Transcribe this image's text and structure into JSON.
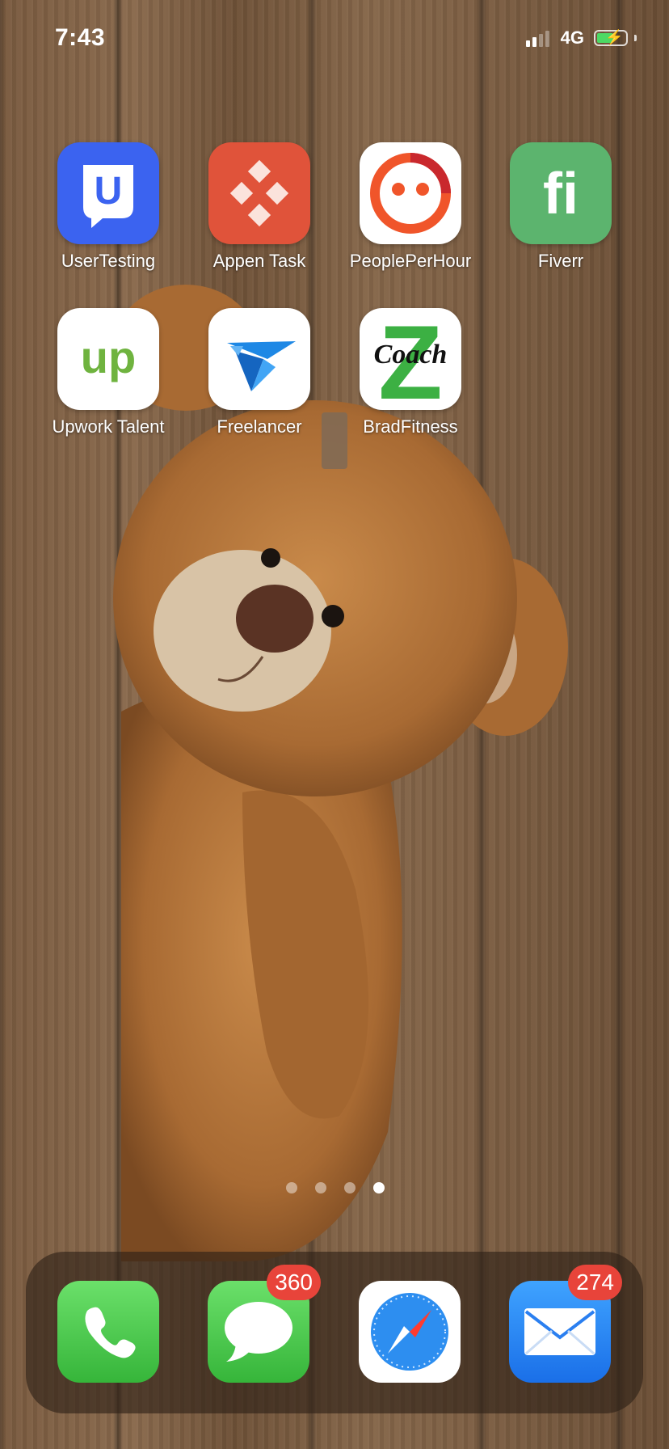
{
  "status_bar": {
    "time": "7:43",
    "network": "4G",
    "battery_charging": true
  },
  "apps": [
    {
      "label": "UserTesting",
      "icon": "usertesting-icon",
      "color": "#3b63f0"
    },
    {
      "label": "Appen Task",
      "icon": "appen-icon",
      "color": "#e0533a"
    },
    {
      "label": "PeoplePerHour",
      "icon": "peopleperhour-icon",
      "color": "#ffffff"
    },
    {
      "label": "Fiverr",
      "icon": "fiverr-icon",
      "color": "#5cb46e"
    },
    {
      "label": "Upwork Talent",
      "icon": "upwork-icon",
      "color": "#ffffff"
    },
    {
      "label": "Freelancer",
      "icon": "freelancer-icon",
      "color": "#ffffff"
    },
    {
      "label": "BradFitness",
      "icon": "bradfitness-icon",
      "color": "#ffffff"
    }
  ],
  "icon_text": {
    "usertesting": "U",
    "upwork": "up",
    "fiverr": "fi",
    "coach": "Coach",
    "z": "Z"
  },
  "page_indicator": {
    "pages": 4,
    "current": 4
  },
  "dock": {
    "apps": [
      {
        "name": "Phone",
        "icon": "phone-icon"
      },
      {
        "name": "Messages",
        "icon": "messages-icon",
        "badge": "360"
      },
      {
        "name": "Safari",
        "icon": "safari-icon"
      },
      {
        "name": "Mail",
        "icon": "mail-icon",
        "badge": "274"
      }
    ]
  }
}
